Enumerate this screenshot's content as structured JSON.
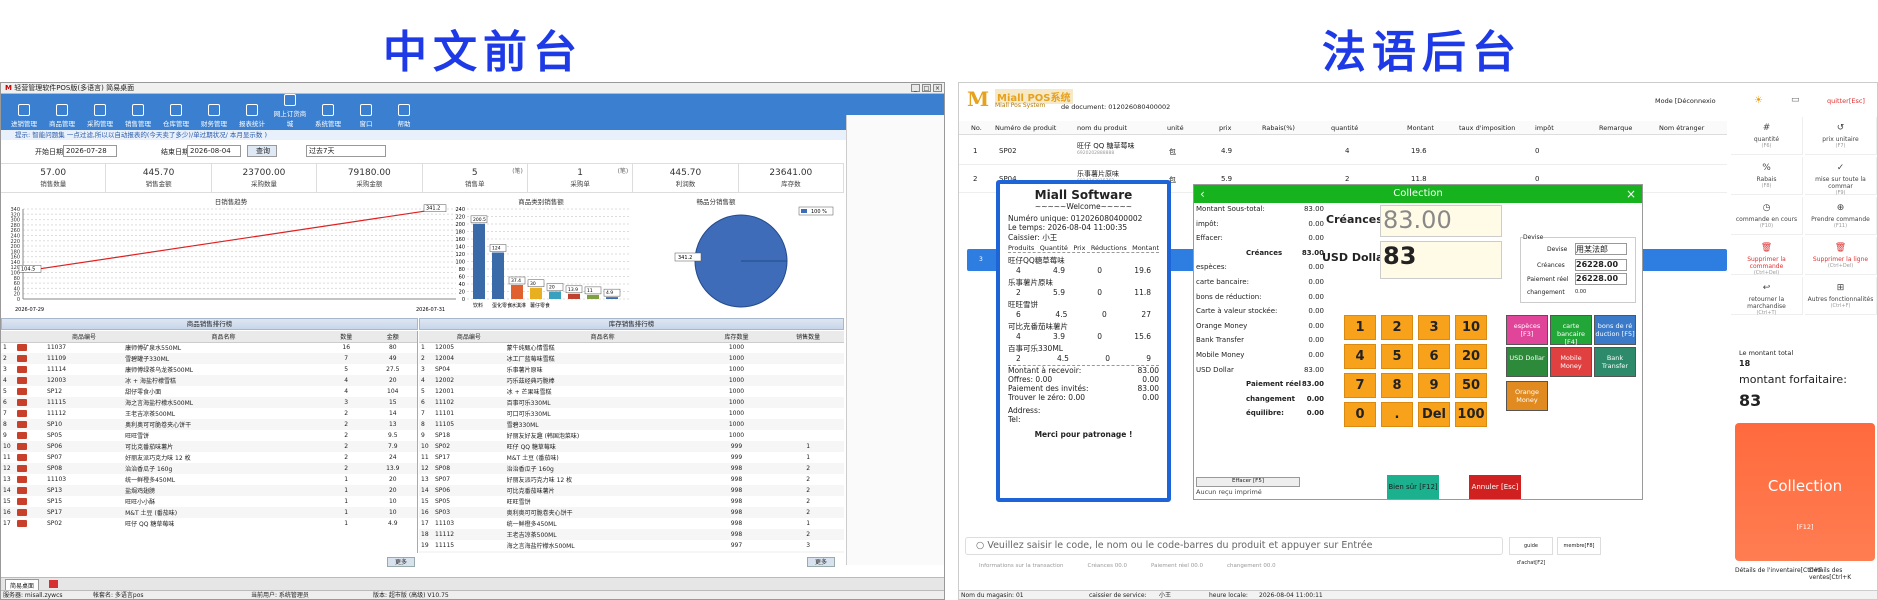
{
  "titles": {
    "left": "中文前台",
    "right": "法语后台"
  },
  "left": {
    "window_title": "轻营管理软件POS版(多语言) 简易桌面",
    "toolbar": [
      "进销管理",
      "商品管理",
      "采购管理",
      "销售管理",
      "仓库管理",
      "财务管理",
      "报表统计",
      "网上订货商城",
      "系统管理",
      "窗口",
      "帮助"
    ],
    "breadcrumb": "提示: 智能问题集   一点过滤,所以以自动报表的(今天卖了多少)/单过期状况/ 本月显示数 )",
    "filters": {
      "start_label": "开始日期",
      "start": "2026-07-28",
      "end_label": "结束日期",
      "end": "2026-08-04",
      "query": "查询",
      "range": "过去7天"
    },
    "stats": [
      {
        "v": "57.00",
        "l": "销售数量",
        "u": ""
      },
      {
        "v": "445.70",
        "l": "销售金额",
        "u": ""
      },
      {
        "v": "23700.00",
        "l": "采购数量",
        "u": ""
      },
      {
        "v": "79180.00",
        "l": "采购金额",
        "u": ""
      },
      {
        "v": "5",
        "l": "销售单",
        "u": "(笔)"
      },
      {
        "v": "1",
        "l": "采购单",
        "u": "(笔)"
      },
      {
        "v": "445.70",
        "l": "利润数",
        "u": ""
      },
      {
        "v": "23641.00",
        "l": "库存数",
        "u": ""
      }
    ],
    "chart_titles": [
      "日销售趋势",
      "商品类别销售额",
      "畅品分销售额"
    ],
    "line_axis": {
      "y": [
        "340",
        "320",
        "300",
        "280",
        "260",
        "240",
        "220",
        "200",
        "180",
        "160",
        "140",
        "120",
        "100",
        "80",
        "60",
        "40",
        "20",
        "0"
      ],
      "start": "2026-07-29",
      "end": "2026-07-31",
      "start_val": "104.5",
      "end_val": "341.2"
    },
    "bar_axis": {
      "y": [
        "240",
        "220",
        "200",
        "180",
        "160",
        "140",
        "120",
        "100",
        "80",
        "60",
        "40",
        "20",
        "0"
      ]
    },
    "pie_labels": {
      "legend": "100 %",
      "slice": "341.2"
    },
    "grid_left_title": "商品销售排行榜",
    "grid_right_title": "库存销售排行榜",
    "left_cols": [
      "商品编号",
      "商品名称",
      "数量",
      "金额"
    ],
    "left_rows": [
      [
        "1",
        "11037",
        "康师傅矿泉水550ML",
        "16",
        "80"
      ],
      [
        "2",
        "11109",
        "雪碧罐子330ML",
        "7",
        "49"
      ],
      [
        "3",
        "11114",
        "康师傅绿茶乌龙茶500ML",
        "5",
        "27.5"
      ],
      [
        "4",
        "12003",
        "冰 + 海盐柠檬雪糕",
        "4",
        "20"
      ],
      [
        "5",
        "SP12",
        "甜仔零食小面",
        "4",
        "104"
      ],
      [
        "6",
        "11115",
        "海之言海盐柠檬水500ML",
        "3",
        "15"
      ],
      [
        "7",
        "11112",
        "王老吉凉茶500ML",
        "2",
        "14"
      ],
      [
        "8",
        "SP10",
        "奥利奥可可脆卷夹心饼干",
        "2",
        "13"
      ],
      [
        "9",
        "SP05",
        "旺旺雪饼",
        "2",
        "9.5"
      ],
      [
        "10",
        "SP06",
        "可比克番茄味薯片",
        "2",
        "7.9"
      ],
      [
        "11",
        "SP07",
        "好丽友派巧克力味 12 枚",
        "2",
        "24"
      ],
      [
        "12",
        "SP08",
        "治治香瓜子 160g",
        "2",
        "13.9"
      ],
      [
        "13",
        "11103",
        "统一鲜橙多450ML",
        "1",
        "20"
      ],
      [
        "14",
        "SP13",
        "盐焗鸡翅膀",
        "1",
        "20"
      ],
      [
        "15",
        "SP15",
        "旺旺小小酥",
        "1",
        "10"
      ],
      [
        "16",
        "SP17",
        "M&T 土豆 (番茄味)",
        "1",
        "10"
      ],
      [
        "17",
        "SP02",
        "旺仔 QQ 糖草莓味",
        "1",
        "4.9"
      ]
    ],
    "right_cols": [
      "商品编号",
      "商品名称",
      "库存数量",
      "销售数量"
    ],
    "right_rows": [
      [
        "1",
        "12005",
        "蒙牛纯甄心情雪糕",
        "1000",
        ""
      ],
      [
        "2",
        "12004",
        "冰工厂蓝莓味雪糕",
        "1000",
        ""
      ],
      [
        "3",
        "SP04",
        "乐事薯片原味",
        "1000",
        ""
      ],
      [
        "4",
        "12002",
        "巧乐兹经典巧脆棒",
        "1000",
        ""
      ],
      [
        "5",
        "12001",
        "冰 + 芒果味雪糕",
        "1000",
        ""
      ],
      [
        "6",
        "11102",
        "百事可乐330ML",
        "1000",
        ""
      ],
      [
        "7",
        "11101",
        "可口可乐330ML",
        "1000",
        ""
      ],
      [
        "8",
        "11105",
        "雪碧330ML",
        "1000",
        ""
      ],
      [
        "9",
        "SP18",
        "好丽友好友趣 (韩国泡菜味)",
        "1000",
        ""
      ],
      [
        "10",
        "SP02",
        "旺仔 QQ 糖草莓味",
        "999",
        "1"
      ],
      [
        "11",
        "SP17",
        "M&T 土豆 (番茄味)",
        "999",
        "1"
      ],
      [
        "12",
        "SP08",
        "治治香瓜子 160g",
        "998",
        "2"
      ],
      [
        "13",
        "SP07",
        "好丽友派巧克力味 12 枚",
        "998",
        "2"
      ],
      [
        "14",
        "SP06",
        "可比克番茄味薯片",
        "998",
        "2"
      ],
      [
        "15",
        "SP05",
        "旺旺雪饼",
        "998",
        "2"
      ],
      [
        "16",
        "SP03",
        "奥利奥可可脆卷夹心饼干",
        "998",
        "2"
      ],
      [
        "17",
        "11103",
        "统一鲜橙多450ML",
        "998",
        "1"
      ],
      [
        "18",
        "11112",
        "王老吉凉茶500ML",
        "998",
        "2"
      ],
      [
        "19",
        "11115",
        "海之言海盐柠檬水500ML",
        "997",
        "3"
      ],
      [
        "20",
        "12003",
        "冰 + 海盐柠檬雪糕",
        "996",
        "4"
      ]
    ],
    "more": "更多",
    "taskbar": "简易桌面",
    "status": {
      "server": "服务器: misall.zywcs",
      "account": "帐套名: 多语言pos",
      "user": "当前用户: 系统管理员",
      "version": "版本: 超市版 (高级) V10.75"
    }
  },
  "chart_data": [
    {
      "type": "line",
      "title": "日销售趋势",
      "x": [
        "2026-07-29",
        "2026-07-31"
      ],
      "series": [
        {
          "values": [
            104.5,
            341.2
          ]
        }
      ],
      "ylim": [
        0,
        340
      ]
    },
    {
      "type": "bar",
      "title": "商品类别销售额",
      "categories": [
        "饮料",
        "蛋化零食",
        "冰淇淋",
        "薯仔零食",
        "",
        "",
        ""
      ],
      "values": [
        200.5,
        124,
        37.4,
        30,
        20,
        13.9,
        11,
        4.9
      ],
      "ylim": [
        0,
        240
      ]
    },
    {
      "type": "pie",
      "title": "畅品分销售额",
      "values": [
        341.2
      ],
      "labels": [
        "100 %"
      ]
    }
  ],
  "right": {
    "brand": "Miall POS系统",
    "brand_sub": "Miall Pos System",
    "doc": "de document: 012026080400002",
    "mode": "Mode [Déconnexio",
    "quit": "quitter[Esc]",
    "cols": [
      "No.",
      "Numéro de produit",
      "nom du produit",
      "unité",
      "prix",
      "Rabais(%)",
      "quantité",
      "Montant",
      "taux d'imposition",
      "impôt",
      "Remarque",
      "Nom étranger"
    ],
    "rows": [
      {
        "no": "1",
        "code": "SP02",
        "name": "旺仔 QQ 糖草莓味",
        "sub": "6920202888888",
        "unit": "包",
        "price": "4.9",
        "qty": "4",
        "amt": "19.6",
        "tax": "0"
      },
      {
        "no": "2",
        "code": "SP04",
        "name": "乐事薯片原味",
        "sub": "6924743915763",
        "unit": "包",
        "price": "5.9",
        "qty": "2",
        "amt": "11.8",
        "tax": "0"
      }
    ],
    "side": [
      {
        "t": "quantité",
        "k": "(F6)"
      },
      {
        "t": "prix unitaire",
        "k": "(F7)"
      },
      {
        "t": "Rabais",
        "k": "(F8)"
      },
      {
        "t": "mise sur toute la commar",
        "k": "(F9)"
      },
      {
        "t": "commande en cours",
        "k": "(F10)"
      },
      {
        "t": "Prendre commande",
        "k": "(F11)"
      },
      {
        "t": "Supprimer la commande",
        "k": "(Ctrl+Del)"
      },
      {
        "t": "Supprimer la ligne",
        "k": "(Ctrl+Del)"
      },
      {
        "t": "retourner la marchandise",
        "k": "(Ctrl+T)"
      },
      {
        "t": "Autres fonctionnalités",
        "k": "(Ctrl+F)"
      }
    ],
    "total_label": "Le montant total",
    "total": "18",
    "forfait_label": "montant forfaitaire:",
    "forfait": "83",
    "collection_btn": "Collection",
    "collection_key": "[F12]",
    "search_placeholder": "Veuillez saisir le code, le nom ou le code-barres du produit et appuyer sur Entrée",
    "search_btns": [
      "guide d'achat[F2]",
      "membre[F8]"
    ],
    "bottom": [
      "Détails de l'inventaire[Ctrl+F",
      "Détails des ventes[Ctrl+K"
    ],
    "bottom_info": [
      "Informations sur la transaction",
      "Créances 00.0",
      "Paiement réel 00.0",
      "changement 00.0"
    ],
    "status": [
      "Nom du magasin: 01",
      "caissier de service:",
      "小王",
      "heure locale:",
      "2026-08-04 11:00:11"
    ],
    "receipt": {
      "title": "Miall Software",
      "welcome": "~~~~~Welcome~~~~~",
      "unique": "Numéro unique: 012026080400002",
      "time": "Le temps: 2026-08-04 11:00:35",
      "cashier": "Caissier: 小王",
      "heads": [
        "Produits",
        "Quantité",
        "Prix",
        "Réductions",
        "Montant"
      ],
      "items": [
        {
          "name": "旺仔QQ糖草莓味",
          "q": "4",
          "p": "4.9",
          "d": "0",
          "m": "19.6"
        },
        {
          "name": "乐事薯片原味",
          "q": "2",
          "p": "5.9",
          "d": "0",
          "m": "11.8"
        },
        {
          "name": "旺旺雪饼",
          "q": "6",
          "p": "4.5",
          "d": "0",
          "m": "27"
        },
        {
          "name": "可比克番茄味薯片",
          "q": "4",
          "p": "3.9",
          "d": "0",
          "m": "15.6"
        },
        {
          "name": "百事可乐330ML",
          "q": "2",
          "p": "4.5",
          "d": "0",
          "m": "9"
        }
      ],
      "summary": [
        [
          "Montant à recevoir:",
          "83.00"
        ],
        [
          "Offres: 0.00",
          "0.00"
        ],
        [
          "Paiement des invités:",
          "83.00"
        ],
        [
          "Trouver le zéro: 0.00",
          "0.00"
        ]
      ],
      "address": "Address:",
      "tel": "Tel:",
      "thanks": "Merci pour patronage !"
    },
    "collection": {
      "title": "Collection",
      "left": [
        [
          "Montant Sous-total:",
          "83.00"
        ],
        [
          "impôt:",
          "0.00"
        ],
        [
          "Effacer:",
          "0.00"
        ],
        [
          "Créances",
          "83.00"
        ],
        [
          "espèces:",
          "0.00"
        ],
        [
          "carte bancaire:",
          "0.00"
        ],
        [
          "bons de réduction:",
          "0.00"
        ],
        [
          "Carte à valeur stockée:",
          "0.00"
        ],
        [
          "Orange Money",
          "0.00"
        ],
        [
          "Bank Transfer",
          "0.00"
        ],
        [
          "Mobile Money",
          "0.00"
        ],
        [
          "USD Dollar",
          "83.00"
        ],
        [
          "Paiement réel",
          "83.00"
        ],
        [
          "changement",
          "0.00"
        ],
        [
          "équilibre:",
          "0.00"
        ]
      ],
      "creances_label": "Créances",
      "creances": "83.00",
      "usd_label": "USD Dollar",
      "usd": "83",
      "devise": "Devise",
      "devise_label": "Devise",
      "devise_val": "用某法郎",
      "cre2_label": "Créances",
      "cre2": "26228.00",
      "paid_label": "Paiement réel",
      "paid": "26228.00",
      "change_label": "changement",
      "change": "0.00",
      "keys": [
        "1",
        "2",
        "3",
        "10",
        "4",
        "5",
        "6",
        "20",
        "7",
        "8",
        "9",
        "50",
        "0",
        ".",
        "Del",
        "100"
      ],
      "pay": [
        {
          "t": "espèces [F3]",
          "c": "#e0459a"
        },
        {
          "t": "carte bancaire [F4]",
          "c": "#23a638"
        },
        {
          "t": "bons de ré duction [F5]",
          "c": "#3a7ac8"
        },
        {
          "t": "USD Dollar",
          "c": "#2d8a3a"
        },
        {
          "t": "Mobile Money",
          "c": "#e04040"
        },
        {
          "t": "Bank Transfer",
          "c": "#2d8a6a"
        },
        {
          "t": "Orange Money",
          "c": "#e08a20"
        }
      ],
      "effacer": "Effacer [F5]",
      "noprint": "Aucun reçu imprimé",
      "ok": "Bien sûr [F12]",
      "cancel": "Annuler [Esc]"
    }
  }
}
